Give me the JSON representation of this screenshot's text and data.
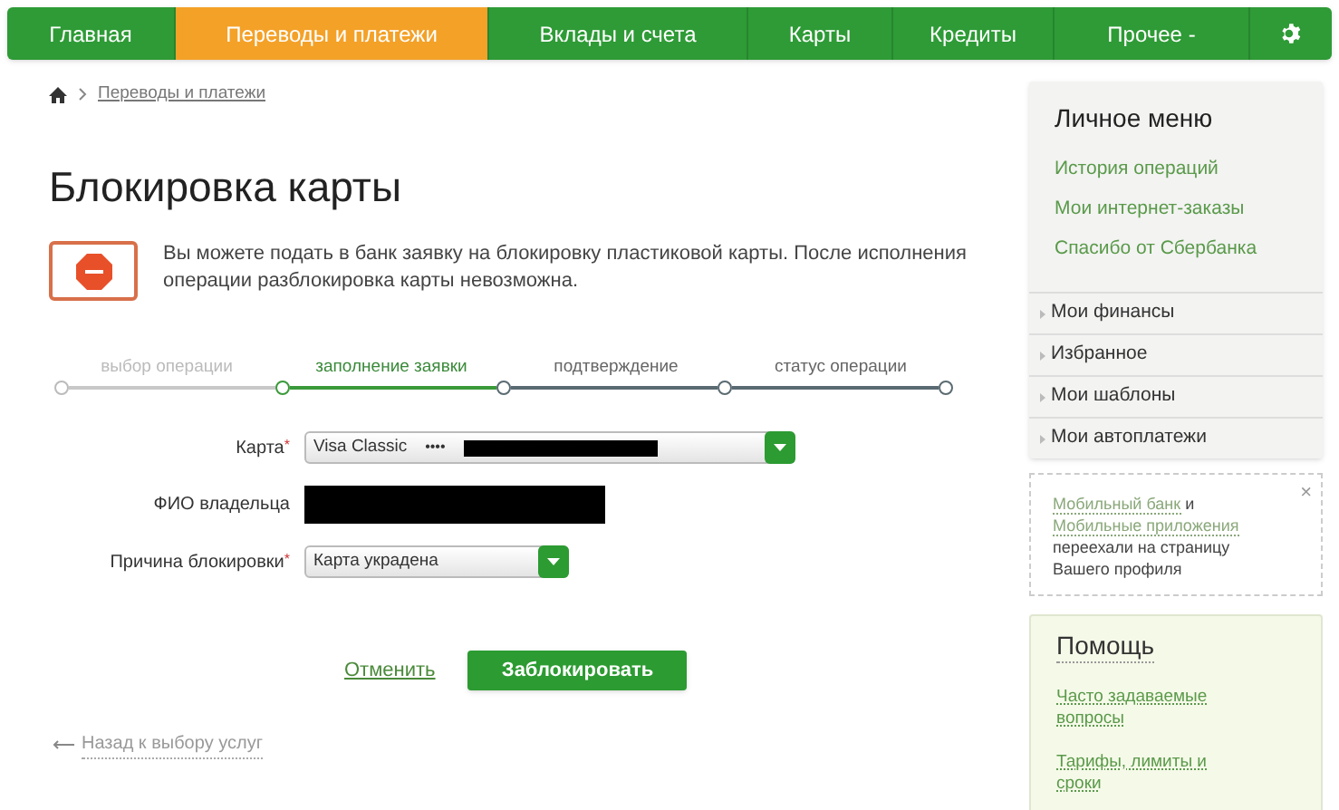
{
  "nav": {
    "tabs": [
      {
        "label": "Главная",
        "selected": false
      },
      {
        "label": "Переводы и платежи",
        "selected": true
      },
      {
        "label": "Вклады и счета",
        "selected": false
      },
      {
        "label": "Карты",
        "selected": false
      },
      {
        "label": "Кредиты",
        "selected": false
      },
      {
        "label": "Прочее -",
        "selected": false
      }
    ]
  },
  "breadcrumb": {
    "items": [
      "Переводы и платежи"
    ]
  },
  "title": "Блокировка карты",
  "notice": "Вы можете подать в банк заявку на блокировку пластиковой карты. После исполнения операции разблокировка карты невозможна.",
  "steps": [
    {
      "label": "выбор операции",
      "done": true,
      "selected": false
    },
    {
      "label": "заполнение заявки",
      "done": false,
      "selected": true
    },
    {
      "label": "подтверждение",
      "done": false,
      "selected": false
    },
    {
      "label": "статус операции",
      "done": false,
      "selected": false
    }
  ],
  "form": {
    "fields": [
      {
        "kind": "select",
        "label": "Карта",
        "required_mark": "*",
        "value": "Visa Classic",
        "masked": "••••",
        "redacted": true
      },
      {
        "kind": "redacted",
        "label": "ФИО владельца"
      },
      {
        "kind": "select",
        "label": "Причина блокировки",
        "required_mark": "*",
        "value": "Карта украдена"
      }
    ]
  },
  "actions": {
    "cancel": "Отменить",
    "submit": "Заблокировать"
  },
  "back_link": "Назад к выбору услуг",
  "sidebar": {
    "personal_menu": {
      "title": "Личное меню",
      "links": [
        "История операций",
        "Мои интернет-заказы",
        "Спасибо от Сбербанка"
      ],
      "sections": [
        "Мои финансы",
        "Избранное",
        "Мои шаблоны",
        "Мои автоплатежи"
      ]
    },
    "moved_notice": {
      "parts": [
        {
          "text": "Мобильный банк",
          "link": true
        },
        {
          "text": " и ",
          "link": false
        },
        {
          "text": "Мобильные приложения",
          "link": true
        },
        {
          "text": " переехали на страницу Вашего профиля",
          "link": false
        }
      ],
      "close": "×"
    },
    "help": {
      "title": "Помощь",
      "links": [
        "Часто задаваемые вопросы",
        "Тарифы, лимиты и сроки"
      ]
    }
  }
}
